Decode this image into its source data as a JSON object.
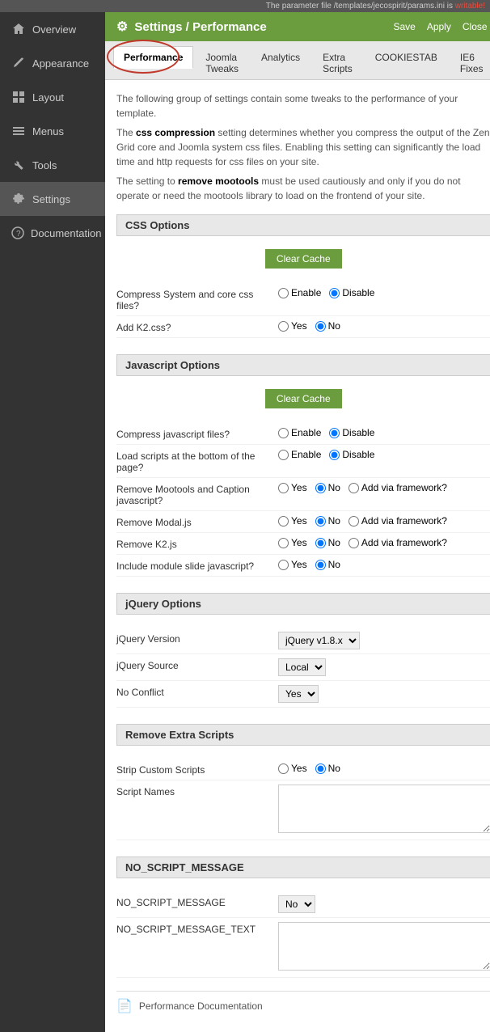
{
  "topbar": {
    "message": "The parameter file /templates/jecospirit/params.ini is ",
    "writable_text": "writable!"
  },
  "header": {
    "icon": "⚙",
    "title": "Settings / Performance",
    "save_label": "Save",
    "apply_label": "Apply",
    "close_label": "Close"
  },
  "tabs": [
    {
      "id": "performance",
      "label": "Performance",
      "active": true
    },
    {
      "id": "joomla-tweaks",
      "label": "Joomla Tweaks",
      "active": false
    },
    {
      "id": "analytics",
      "label": "Analytics",
      "active": false
    },
    {
      "id": "extra-scripts",
      "label": "Extra Scripts",
      "active": false
    },
    {
      "id": "cookiestab",
      "label": "COOKIESTAB",
      "active": false
    },
    {
      "id": "ie6-fixes",
      "label": "IE6 Fixes",
      "active": false
    }
  ],
  "info_texts": [
    "The following group of settings contain some tweaks to the performance of your template.",
    "The css compression setting determines whether you compress the output of the Zen Grid core and Joomla system css files. Enabling this setting can significantly the load time and http requests for css files on your site.",
    "The setting to remove mootools must be used cautiously and only if you do not operate or need the mootools library to load on the frontend of your site."
  ],
  "css_options": {
    "title": "CSS Options",
    "clear_cache_label": "Clear Cache",
    "fields": [
      {
        "label": "Compress System and core css files?",
        "type": "radio",
        "options": [
          "Enable",
          "Disable"
        ],
        "selected": "Disable"
      },
      {
        "label": "Add K2.css?",
        "type": "radio",
        "options": [
          "Yes",
          "No"
        ],
        "selected": "No"
      }
    ]
  },
  "javascript_options": {
    "title": "Javascript Options",
    "clear_cache_label": "Clear Cache",
    "fields": [
      {
        "label": "Compress javascript files?",
        "type": "radio",
        "options": [
          "Enable",
          "Disable"
        ],
        "selected": "Disable"
      },
      {
        "label": "Load scripts at the bottom of the page?",
        "type": "radio",
        "options": [
          "Enable",
          "Disable"
        ],
        "selected": "Disable"
      },
      {
        "label": "Remove Mootools and Caption javascript?",
        "type": "radio",
        "options": [
          "Yes",
          "No",
          "Add via framework?"
        ],
        "selected": "No"
      },
      {
        "label": "Remove Modal.js",
        "type": "radio",
        "options": [
          "Yes",
          "No",
          "Add via framework?"
        ],
        "selected": "No"
      },
      {
        "label": "Remove K2.js",
        "type": "radio",
        "options": [
          "Yes",
          "No",
          "Add via framework?"
        ],
        "selected": "No"
      },
      {
        "label": "Include module slide javascript?",
        "type": "radio",
        "options": [
          "Yes",
          "No"
        ],
        "selected": "No"
      }
    ]
  },
  "jquery_options": {
    "title": "jQuery Options",
    "fields": [
      {
        "label": "jQuery Version",
        "type": "select",
        "options": [
          "jQuery v1.8.x"
        ],
        "selected": "jQuery v1.8.x"
      },
      {
        "label": "jQuery Source",
        "type": "select",
        "options": [
          "Local"
        ],
        "selected": "Local"
      },
      {
        "label": "No Conflict",
        "type": "select",
        "options": [
          "Yes"
        ],
        "selected": "Yes"
      }
    ]
  },
  "remove_extra_scripts": {
    "title": "Remove Extra Scripts",
    "fields": [
      {
        "label": "Strip Custom Scripts",
        "type": "radio",
        "options": [
          "Yes",
          "No"
        ],
        "selected": "No"
      },
      {
        "label": "Script Names",
        "type": "textarea",
        "value": ""
      }
    ]
  },
  "no_script": {
    "title": "NO_SCRIPT_MESSAGE",
    "fields": [
      {
        "label": "NO_SCRIPT_MESSAGE",
        "type": "select",
        "options": [
          "No"
        ],
        "selected": "No"
      },
      {
        "label": "NO_SCRIPT_MESSAGE_TEXT",
        "type": "textarea",
        "value": ""
      }
    ]
  },
  "documentation": {
    "label": "Performance Documentation"
  },
  "sidebar": {
    "items": [
      {
        "id": "overview",
        "label": "Overview",
        "icon": "🏠"
      },
      {
        "id": "appearance",
        "label": "Appearance",
        "icon": "✏"
      },
      {
        "id": "layout",
        "label": "Layout",
        "icon": "▦"
      },
      {
        "id": "menus",
        "label": "Menus",
        "icon": "☰"
      },
      {
        "id": "tools",
        "label": "Tools",
        "icon": "🔧"
      },
      {
        "id": "settings",
        "label": "Settings",
        "icon": "⚙",
        "active": true
      },
      {
        "id": "documentation",
        "label": "Documentation",
        "icon": "?"
      }
    ]
  }
}
